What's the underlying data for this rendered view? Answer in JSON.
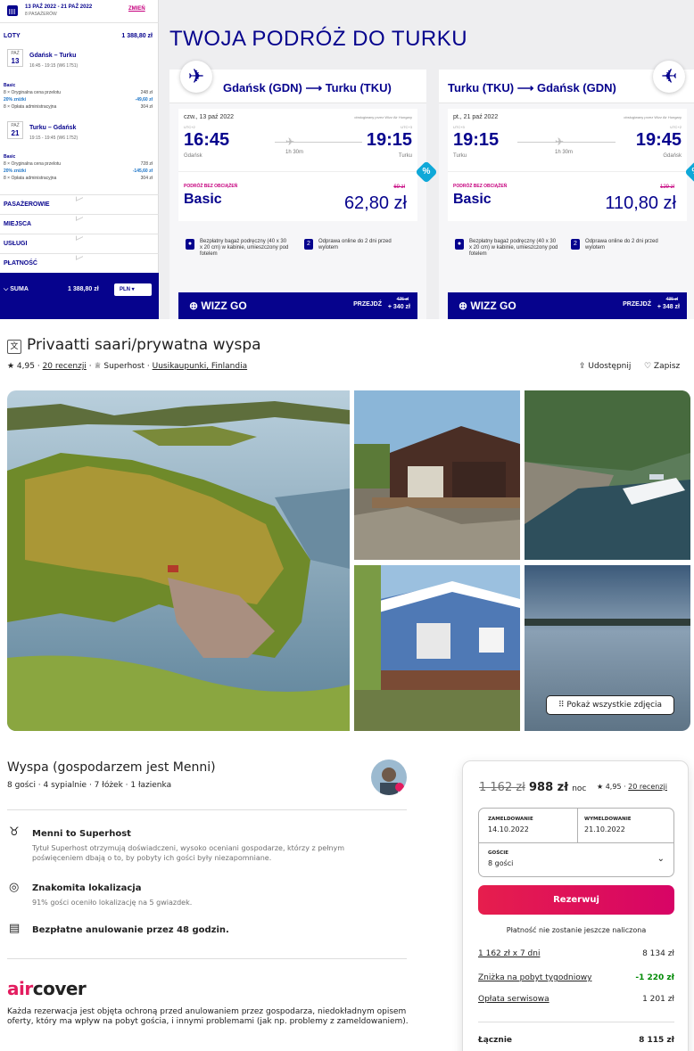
{
  "wizz": {
    "sidebar": {
      "dates": "13 PAŹ 2022 - 21 PAŹ 2022",
      "passengers": "8 PASAŻERÓW",
      "change": "ZMIEŃ",
      "flights_label": "LOTY",
      "flights_total": "1 388,80 zł",
      "outbound": {
        "month": "PAŹ",
        "day": "13",
        "route": "Gdańsk – Turku",
        "time": "16:45 - 19:15 (W6 1751)",
        "fare_name": "Basic",
        "lines": [
          {
            "label": "8 × Oryginalna cena przelotu",
            "value": "248 zł",
            "kind": "normal"
          },
          {
            "label": "20% zniżki",
            "value": "-49,60 zł",
            "kind": "disc"
          },
          {
            "label": "8 × Opłata administracyjna",
            "value": "304 zł",
            "kind": "normal"
          }
        ]
      },
      "inbound": {
        "month": "PAŹ",
        "day": "21",
        "route": "Turku – Gdańsk",
        "time": "19:15 - 19:45 (W6 1752)",
        "fare_name": "Basic",
        "lines": [
          {
            "label": "8 × Oryginalna cena przelotu",
            "value": "728 zł",
            "kind": "normal"
          },
          {
            "label": "20% zniżki",
            "value": "-145,60 zł",
            "kind": "disc"
          },
          {
            "label": "8 × Opłata administracyjna",
            "value": "304 zł",
            "kind": "normal"
          }
        ]
      },
      "accordions": [
        "PASAŻEROWIE",
        "MIEJSCA",
        "USŁUGI",
        "PŁATNOŚĆ"
      ],
      "sum_label": "SUMA",
      "sum_value": "1 388,80 zł",
      "currency": "PLN"
    },
    "title": "TWOJA PODRÓŻ DO TURKU",
    "cards": [
      {
        "route": "Gdańsk (GDN) ⟶ Turku (TKU)",
        "date": "czw., 13 paź 2022",
        "operated": "obsługiwany przez Wizz Air Hungary",
        "dep_tz": "UTC+2",
        "arr_tz": "UTC+3",
        "dep": "16:45",
        "arr": "19:15",
        "dep_city": "Gdańsk",
        "arr_city": "Turku",
        "duration": "1h 30m",
        "fare_label": "PODRÓŻ BEZ OBCIĄŻEŃ",
        "fare": "Basic",
        "old_price": "69 zł",
        "price": "62,80 zł",
        "badge": "%",
        "feat1": "Bezpłatny bagaż podręczny (40 x 30 x 20 cm) w kabinie, umieszczony pod fotelem",
        "feat2": "Odprawa online do 2 dni przed wylotem",
        "feat2_icon": "2",
        "go_label": "WIZZ GO",
        "go_action": "PRZEJDŹ",
        "go_old": "425 zł",
        "go_price": "+ 340 zł"
      },
      {
        "route": "Turku (TKU) ⟶ Gdańsk (GDN)",
        "date": "pt., 21 paź 2022",
        "operated": "obsługiwany przez Wizz Air Hungary",
        "dep_tz": "UTC+3",
        "arr_tz": "UTC+2",
        "dep": "19:15",
        "arr": "19:45",
        "dep_city": "Turku",
        "arr_city": "Gdańsk",
        "duration": "1h 30m",
        "fare_label": "PODRÓŻ BEZ OBCIĄŻEŃ",
        "fare": "Basic",
        "old_price": "129 zł",
        "price": "110,80 zł",
        "badge": "%",
        "feat1": "Bezpłatny bagaż podręczny (40 x 30 x 20 cm) w kabinie, umieszczony pod fotelem",
        "feat2": "Odprawa online do 2 dni przed wylotem",
        "feat2_icon": "2",
        "go_label": "WIZZ GO",
        "go_action": "PRZEJDŹ",
        "go_old": "435 zł",
        "go_price": "+ 348 zł"
      }
    ]
  },
  "airbnb": {
    "title": "Privaatti saari/prywatna wyspa",
    "translate_icon": "文",
    "rating": "★ 4,95 ·",
    "reviews": "20 recenzji",
    "superhost": "· ♕ Superhost ·",
    "location": "Uusikaupunki, Finlandia",
    "share": "⇪ Udostępnij",
    "save": "♡ Zapisz",
    "show_all": "⠿ Pokaż wszystkie zdjęcia",
    "host_title": "Wyspa (gospodarzem jest Menni)",
    "host_sub": "8 gości · 4 sypialnie · 7 łóżek · 1 łazienka",
    "highlights": [
      {
        "icon": "♉",
        "title": "Menni to Superhost",
        "desc": "Tytuł Superhost otrzymują doświadczeni, wysoko oceniani gospodarze, którzy z pełnym poświęceniem dbają o to, by pobyty ich gości były niezapomniane."
      },
      {
        "icon": "◎",
        "title": "Znakomita lokalizacja",
        "desc": "91% gości oceniło lokalizację na 5 gwiazdek."
      },
      {
        "icon": "▤",
        "title": "Bezpłatne anulowanie przez 48 godzin.",
        "desc": ""
      }
    ],
    "aircover_a": "air",
    "aircover_b": "cover",
    "aircover_text": "Każda rezerwacja jest objęta ochroną przed anulowaniem przez gospodarza, niedokładnym opisem oferty, który ma wpływ na pobyt gościa, i innymi problemami (jak np. problemy z zameldowaniem).",
    "booking": {
      "old_price": "1 162 zł",
      "price": "988 zł",
      "per": "noc",
      "rating": "★ 4,95 ·",
      "reviews": "20 recenzji",
      "checkin_label": "ZAMELDOWANIE",
      "checkin": "14.10.2022",
      "checkout_label": "WYMELDOWANIE",
      "checkout": "21.10.2022",
      "guests_label": "GOŚCIE",
      "guests": "8 gości",
      "reserve": "Rezerwuj",
      "note": "Płatność nie zostanie jeszcze naliczona",
      "rows": [
        {
          "label": "1 162 zł x 7 dni",
          "value": "8 134 zł"
        },
        {
          "label": "Zniżka na pobyt tygodniowy",
          "value": "-1 220 zł"
        },
        {
          "label": "Opłata serwisowa",
          "value": "1 201 zł"
        }
      ],
      "total_label": "Łącznie",
      "total": "8 115 zł"
    }
  }
}
